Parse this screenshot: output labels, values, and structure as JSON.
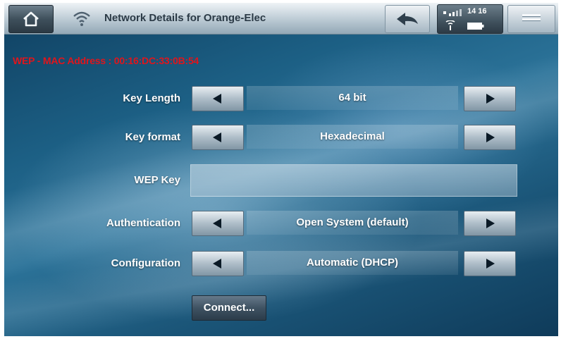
{
  "header": {
    "title": "Network Details for Orange-Elec",
    "home_icon": "home-icon",
    "wifi_icon": "wifi-icon",
    "back_icon": "back-arrow-icon",
    "menu_icon": "menu-icon"
  },
  "status": {
    "clock": "14 16",
    "volume_icon": "volume-icon",
    "signal_icon": "signal-icon",
    "battery_icon": "battery-icon"
  },
  "info": {
    "mac_line": "WEP - MAC Address : 00:16:DC:33:0B:54"
  },
  "rows": [
    {
      "label": "Key Length",
      "value": "64 bit"
    },
    {
      "label": "Key format",
      "value": "Hexadecimal"
    },
    {
      "label": "WEP Key",
      "value": ""
    },
    {
      "label": "Authentication",
      "value": "Open System (default)"
    },
    {
      "label": "Configuration",
      "value": "Automatic (DHCP)"
    }
  ],
  "connect_label": "Connect...",
  "colors": {
    "mac_text": "#e0151c",
    "label_text": "#ffffff",
    "background": "#1c5f84"
  }
}
